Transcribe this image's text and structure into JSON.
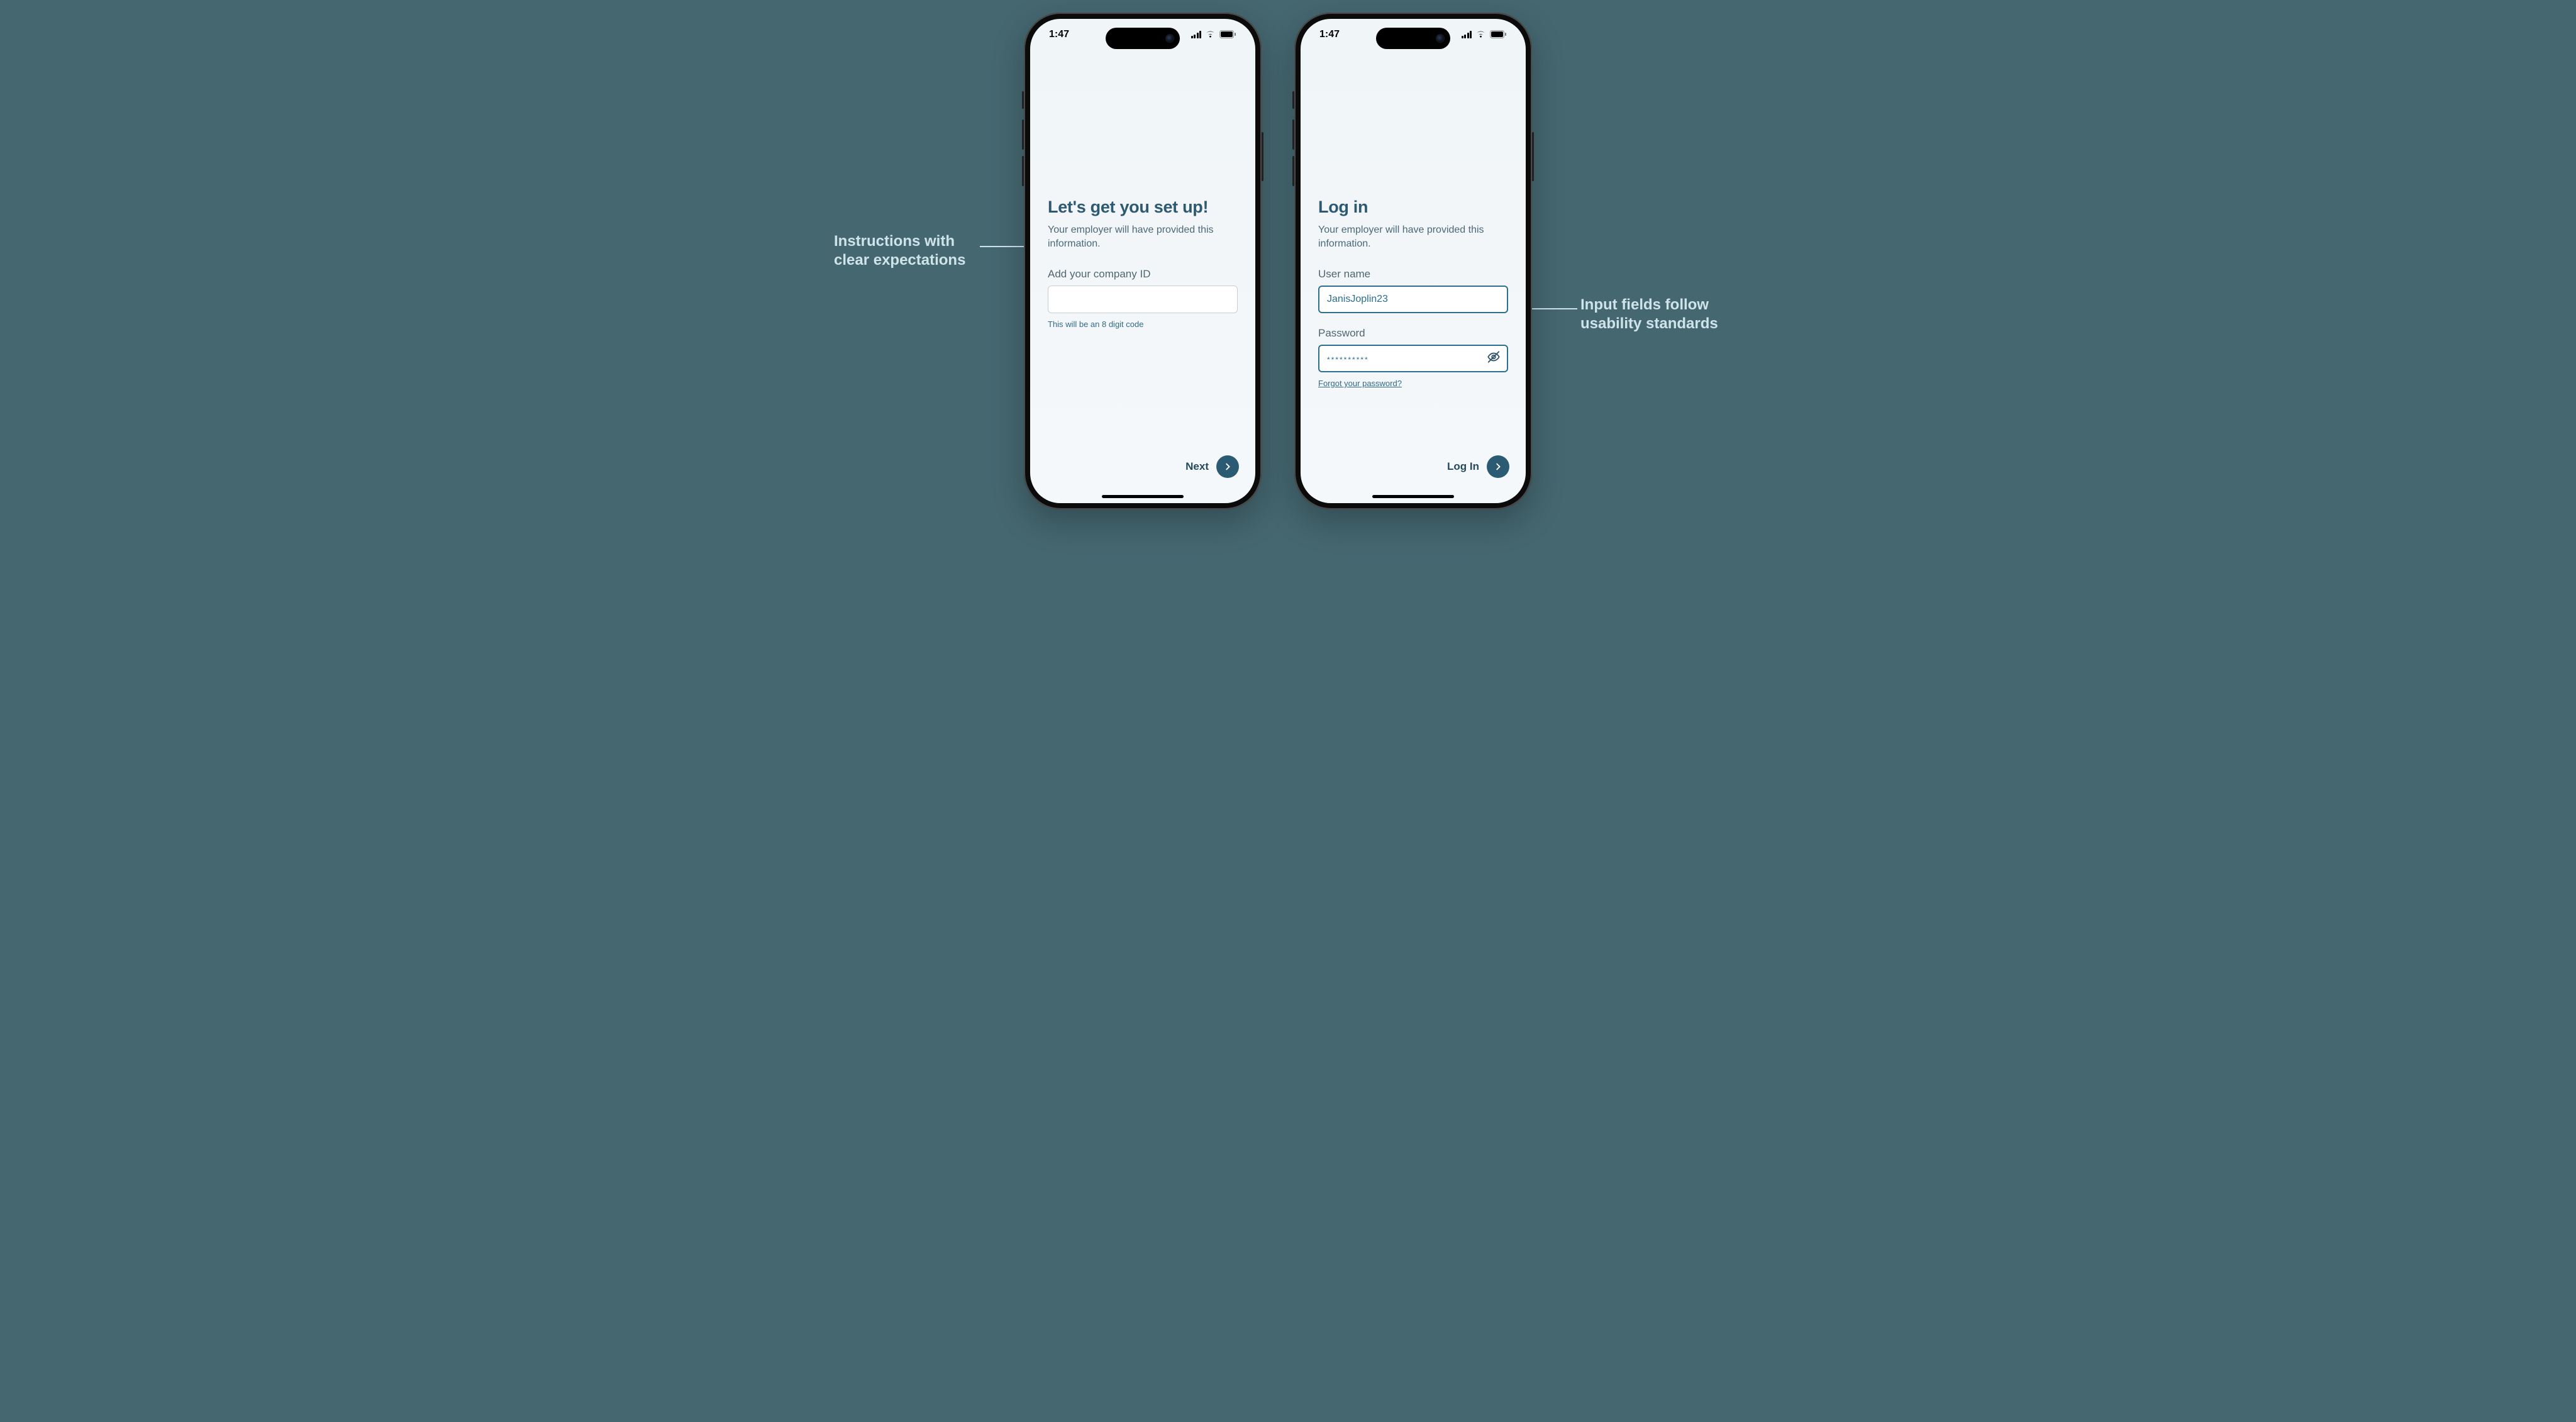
{
  "statusbar": {
    "time": "1:47"
  },
  "annotations": {
    "left_line1": "Instructions with",
    "left_line2": "clear expectations",
    "right_line1": "Input fields follow",
    "right_line2": "usability standards"
  },
  "screen_a": {
    "title": "Let's get you set up!",
    "subtitle": "Your employer will have provided this information.",
    "field_label": "Add your company ID",
    "field_value": "",
    "hint": "This will be an 8 digit code",
    "cta": "Next"
  },
  "screen_b": {
    "title": "Log in",
    "subtitle": "Your employer will have provided this information.",
    "user_label": "User name",
    "user_value": "JanisJoplin23",
    "pw_label": "Password",
    "pw_value": "**********",
    "forgot": "Forgot your password?",
    "cta": "Log In"
  }
}
